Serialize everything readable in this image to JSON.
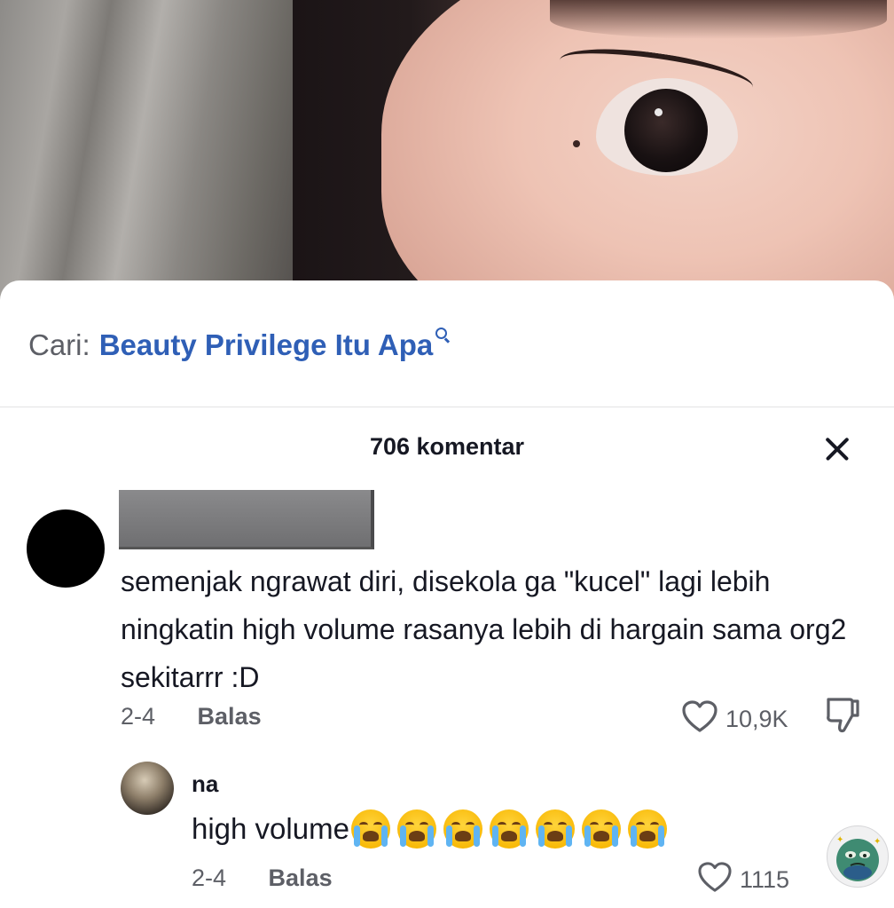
{
  "search": {
    "prefix": "Cari:",
    "query": "Beauty Privilege Itu Apa"
  },
  "comments_header": {
    "count_label": "706 komentar"
  },
  "comments": [
    {
      "text": "semenjak ngrawat diri, disekola ga \"kucel\" lagi lebih ningkatin high volume rasanya lebih di hargain sama org2 sekitarrr :D",
      "date": "2-4",
      "reply_label": "Balas",
      "likes": "10,9K"
    }
  ],
  "replies": [
    {
      "username": "na",
      "text": "high volume",
      "emoji_count": 7,
      "emoji": "loudly-crying-face",
      "date": "2-4",
      "reply_label": "Balas",
      "likes": "1115"
    }
  ],
  "colors": {
    "link": "#2f5fb6",
    "text": "#161823",
    "muted": "#5d5f66"
  }
}
